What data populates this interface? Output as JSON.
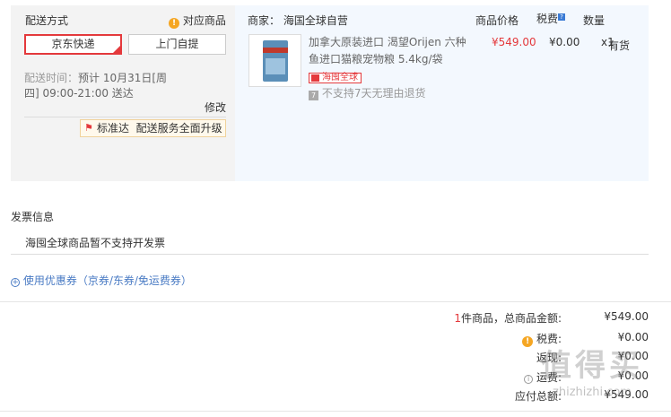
{
  "delivery": {
    "title": "配送方式",
    "match_link": "对应商品",
    "options": [
      "京东快递",
      "上门自提"
    ],
    "time_label": "配送时间：",
    "time_value": "预计 10月31日[周四] 09:00-21:00 送达",
    "edit": "修改",
    "badge_label": "标准达",
    "badge_text": "配送服务全面升级"
  },
  "order": {
    "seller_label": "商家：",
    "seller": "海国全球自营",
    "col_price": "商品价格",
    "col_tax": "税费",
    "col_qty": "数量",
    "product_name": "加拿大原装进口 渴望Orijen 六种鱼进口猫粮宠物粮 5.4kg/袋",
    "price": "¥549.00",
    "tax": "¥0.00",
    "qty": "x1",
    "stock": "有货",
    "tag": "海囤全球",
    "no_return": "不支持7天无理由退货"
  },
  "invoice": {
    "title": "发票信息",
    "note": "海囤全球商品暂不支持开发票"
  },
  "coupon": {
    "label": "使用优惠券（京券/东券/免运费券）"
  },
  "summary": {
    "count": "1",
    "count_label": "件商品，总商品金额:",
    "goods_total": "¥549.00",
    "tax_label": "税费:",
    "tax_value": "¥0.00",
    "row3_label": "返现:",
    "row3_value": "¥0.00",
    "row4_label": "运费:",
    "row4_value": "¥0.00",
    "payable_label": "应付总额:",
    "payable_value": "¥549.00"
  },
  "watermark": {
    "text": "值得买",
    "domain": "zhizhizhi.com"
  },
  "colors": {
    "accent_red": "#e4393c",
    "panel_gray": "#f3f3f3",
    "panel_blue": "#f3f8fe",
    "link_blue": "#4a7bc4"
  }
}
